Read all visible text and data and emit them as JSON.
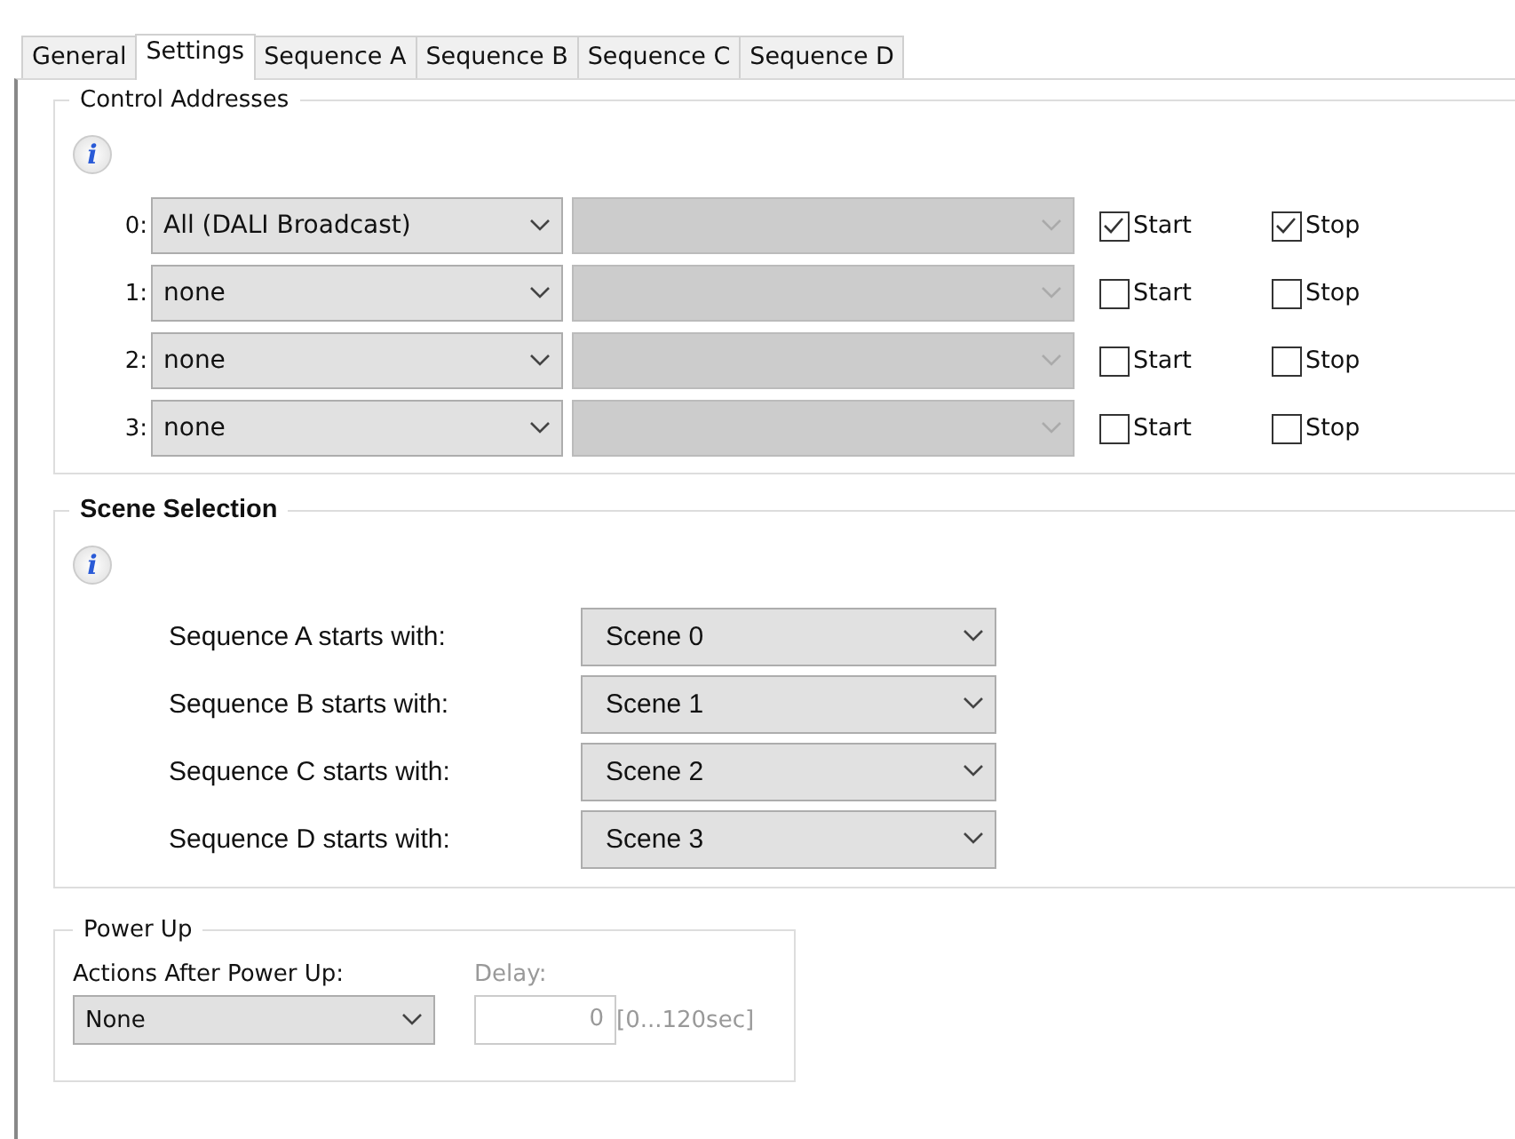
{
  "tabs": [
    {
      "label": "General",
      "selected": false
    },
    {
      "label": "Settings",
      "selected": true
    },
    {
      "label": "Sequence A",
      "selected": false
    },
    {
      "label": "Sequence B",
      "selected": false
    },
    {
      "label": "Sequence C",
      "selected": false
    },
    {
      "label": "Sequence D",
      "selected": false
    }
  ],
  "control_addresses": {
    "title": "Control Addresses",
    "info_icon": "i",
    "rows": [
      {
        "index": "0:",
        "address": "All (DALI Broadcast)",
        "secondary_disabled": true,
        "start_label": "Start",
        "start_checked": true,
        "stop_label": "Stop",
        "stop_checked": true
      },
      {
        "index": "1:",
        "address": "none",
        "secondary_disabled": true,
        "start_label": "Start",
        "start_checked": false,
        "stop_label": "Stop",
        "stop_checked": false
      },
      {
        "index": "2:",
        "address": "none",
        "secondary_disabled": true,
        "start_label": "Start",
        "start_checked": false,
        "stop_label": "Stop",
        "stop_checked": false
      },
      {
        "index": "3:",
        "address": "none",
        "secondary_disabled": true,
        "start_label": "Start",
        "start_checked": false,
        "stop_label": "Stop",
        "stop_checked": false
      }
    ]
  },
  "scene_selection": {
    "title": "Scene Selection",
    "info_icon": "i",
    "rows": [
      {
        "label": "Sequence A starts with:",
        "value": "Scene 0"
      },
      {
        "label": "Sequence B starts with:",
        "value": "Scene 1"
      },
      {
        "label": "Sequence C starts with:",
        "value": "Scene 2"
      },
      {
        "label": "Sequence D starts with:",
        "value": "Scene 3"
      }
    ]
  },
  "power_up": {
    "title": "Power Up",
    "action_label": "Actions After Power Up:",
    "action_value": "None",
    "delay_label": "Delay:",
    "delay_value": "0",
    "delay_range": "[0...120sec]",
    "delay_disabled": true
  }
}
